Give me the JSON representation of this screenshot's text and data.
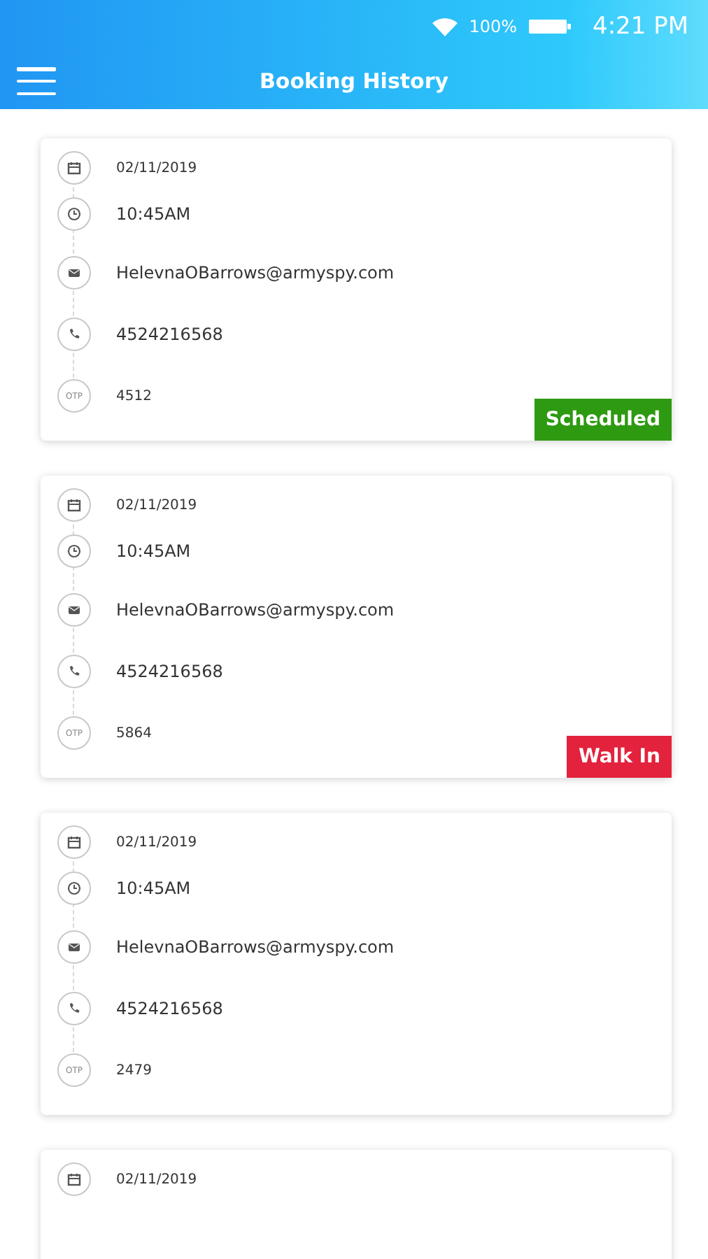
{
  "status_bar": {
    "battery": "100%",
    "time": "4:21 PM"
  },
  "header": {
    "title": "Booking History"
  },
  "bookings": [
    {
      "rows": [
        {
          "kind": "date",
          "text": "02/11/2019"
        },
        {
          "kind": "time",
          "text": "10:45AM"
        },
        {
          "kind": "email",
          "text": "HelevnaOBarrows@armyspy.com"
        },
        {
          "kind": "phone",
          "text": "4524216568"
        },
        {
          "kind": "otp",
          "icon_text": "OTP",
          "text": "4512"
        }
      ],
      "status": {
        "kind": "scheduled",
        "label": "Scheduled"
      }
    },
    {
      "rows": [
        {
          "kind": "date",
          "text": "02/11/2019"
        },
        {
          "kind": "time",
          "text": "10:45AM"
        },
        {
          "kind": "email",
          "text": "HelevnaOBarrows@armyspy.com"
        },
        {
          "kind": "phone",
          "text": "4524216568"
        },
        {
          "kind": "otp",
          "icon_text": "OTP",
          "text": "5864"
        }
      ],
      "status": {
        "kind": "walk_in",
        "label": "Walk In"
      }
    },
    {
      "rows": [
        {
          "kind": "date",
          "text": "02/11/2019"
        },
        {
          "kind": "time",
          "text": "10:45AM"
        },
        {
          "kind": "email",
          "text": "HelevnaOBarrows@armyspy.com"
        },
        {
          "kind": "phone",
          "text": "4524216568"
        },
        {
          "kind": "otp",
          "icon_text": "OTP",
          "text": "2479"
        }
      ]
    },
    {
      "rows": [
        {
          "kind": "date",
          "text": "02/11/2019"
        }
      ]
    }
  ]
}
